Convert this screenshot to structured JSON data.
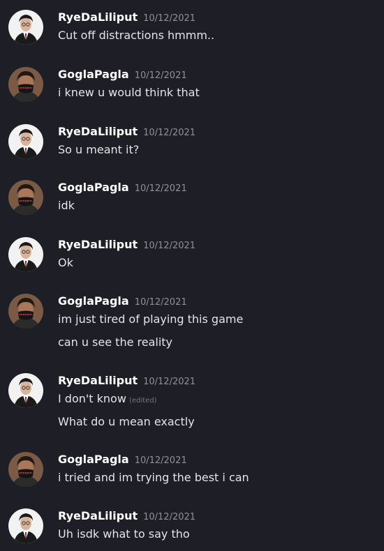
{
  "users": {
    "rye": {
      "name": "RyeDaLiliput",
      "avatar_icon": "harry-potter-avatar-icon"
    },
    "gogla": {
      "name": "GoglaPagla",
      "avatar_icon": "masked-person-avatar-icon"
    }
  },
  "messages": [
    {
      "author": "RyeDaLiliput",
      "time": "10/12/2021",
      "lines": [
        "Cut off distractions hmmm.."
      ]
    },
    {
      "author": "GoglaPagla",
      "time": "10/12/2021",
      "lines": [
        "i knew u would think that"
      ]
    },
    {
      "author": "RyeDaLiliput",
      "time": "10/12/2021",
      "lines": [
        "So u meant it?"
      ]
    },
    {
      "author": "GoglaPagla",
      "time": "10/12/2021",
      "lines": [
        "idk"
      ]
    },
    {
      "author": "RyeDaLiliput",
      "time": "10/12/2021",
      "lines": [
        "Ok"
      ]
    },
    {
      "author": "GoglaPagla",
      "time": "10/12/2021",
      "lines": [
        "im just tired of playing this game",
        "can u see the reality"
      ]
    },
    {
      "author": "RyeDaLiliput",
      "time": "10/12/2021",
      "lines": [
        "I don't know",
        "What do u mean exactly"
      ],
      "edited_label": "(edited)"
    },
    {
      "author": "GoglaPagla",
      "time": "10/12/2021",
      "lines": [
        "i tried and im trying the best i can"
      ]
    },
    {
      "author": "RyeDaLiliput",
      "time": "10/12/2021",
      "lines": [
        "Uh isdk what to say tho"
      ]
    }
  ]
}
